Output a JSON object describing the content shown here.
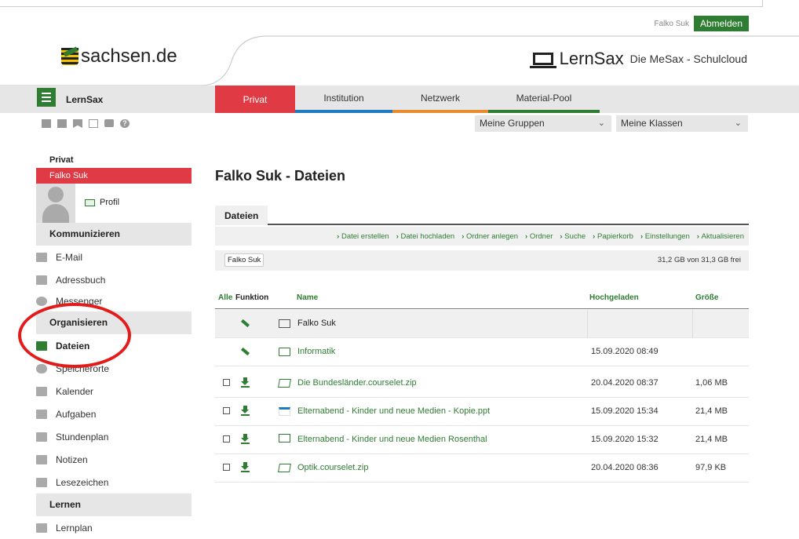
{
  "header": {
    "username": "Falko Suk",
    "logout_label": "Abmelden",
    "logo_text": "sachsen.de",
    "brand": "LernSax",
    "tagline": "Die MeSax - Schulcloud"
  },
  "navbar": {
    "app_label": "LernSax",
    "tabs": [
      "Privat",
      "Institution",
      "Netzwerk",
      "Material-Pool"
    ]
  },
  "selects": {
    "groups": "Meine Gruppen",
    "classes": "Meine Klassen"
  },
  "toolbar_icons": [
    "sitemap-icon",
    "notes-icon",
    "bookmark-icon",
    "login-icon",
    "print-icon",
    "help-icon"
  ],
  "sidebar": {
    "title": "Privat",
    "user": "Falko Suk",
    "profile_label": "Profil",
    "sections": {
      "kommunizieren": "Kommunizieren",
      "organisieren": "Organisieren",
      "lernen": "Lernen"
    },
    "items": {
      "email": "E-Mail",
      "adressbuch": "Adressbuch",
      "messenger": "Messenger",
      "dateien": "Dateien",
      "speicherorte": "Speicherorte",
      "kalender": "Kalender",
      "aufgaben": "Aufgaben",
      "stundenplan": "Stundenplan",
      "notizen": "Notizen",
      "lesezeichen": "Lesezeichen",
      "lernplan": "Lernplan"
    }
  },
  "main": {
    "title": "Falko Suk - Dateien",
    "subtab": "Dateien",
    "actions": [
      "Datei erstellen",
      "Datei hochladen",
      "Ordner anlegen",
      "Ordner",
      "Suche",
      "Papierkorb",
      "Einstellungen",
      "Aktualisieren"
    ],
    "breadcrumb": "Falko Suk",
    "quota": "31,2 GB von 31,3 GB frei",
    "columns": {
      "alle": "Alle",
      "funktion": "Funktion",
      "name": "Name",
      "hochgeladen": "Hochgeladen",
      "groesse": "Größe"
    },
    "rows": [
      {
        "name": "Falko Suk",
        "date": "",
        "size": ""
      },
      {
        "name": "Informatik",
        "date": "15.09.2020 08:49",
        "size": ""
      },
      {
        "name": "Die Bundesländer.courselet.zip",
        "date": "20.04.2020 08:37",
        "size": "1,06 MB"
      },
      {
        "name": "Elternabend - Kinder und neue Medien - Kopie.ppt",
        "date": "15.09.2020 15:34",
        "size": "21,4 MB"
      },
      {
        "name": "Elternabend - Kinder und neue Medien Rosenthal",
        "date": "15.09.2020 15:32",
        "size": "21,4 MB"
      },
      {
        "name": "Optik.courselet.zip",
        "date": "20.04.2020 08:36",
        "size": "97,9 KB"
      }
    ]
  },
  "colors": {
    "green": "#2e7d32",
    "red": "#e03b45",
    "blue": "#1e7bbf",
    "orange": "#e88a2d",
    "annotation": "#e31b1b"
  }
}
